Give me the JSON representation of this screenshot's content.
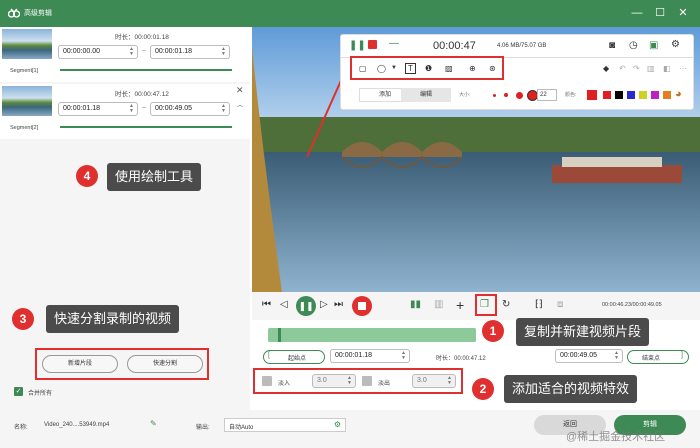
{
  "window": {
    "title": "高级剪辑"
  },
  "segments": [
    {
      "name": "Segment[1]",
      "duration_label": "时长：00:00:01.18",
      "start": "00:00:00.00",
      "end": "00:00:01.18",
      "progress": 1.0
    },
    {
      "name": "Segment[2]",
      "duration_label": "时长：00:00:47.12",
      "start": "00:00:01.18",
      "end": "00:00:49.05",
      "progress": 1.0
    }
  ],
  "tilde": "~",
  "recorder": {
    "time": "00:00:47",
    "size": "4.06 MB/75.07 GB",
    "tab_add": "添加",
    "tab_edit": "编辑",
    "size_label": "大小:",
    "size_value": "22",
    "color_label": "颜色:"
  },
  "palette": [
    "#e02020",
    "#e02020",
    "#000000",
    "#000000",
    "#2a2ad0",
    "#d0d020",
    "#c020c0",
    "#e08020"
  ],
  "callouts": {
    "c1": {
      "num": "1",
      "text": "复制并新建视频片段"
    },
    "c2": {
      "num": "2",
      "text": "添加适合的视频特效"
    },
    "c3": {
      "num": "3",
      "text": "快速分割录制的视频"
    },
    "c4": {
      "num": "4",
      "text": "使用绘制工具"
    }
  },
  "player": {
    "time": "00:00:46.23/00:00:49.05",
    "play_progress": 0.94
  },
  "trim": {
    "start_btn": "起始点",
    "start_value": "00:00:01.18",
    "duration_label": "时长：00:00:47.12",
    "end_value": "00:00:49.05",
    "end_btn": "结束点",
    "timeline_fill": 1.0
  },
  "effects": {
    "fadein_label": "淡入",
    "fadein_value": "3.0",
    "fadeout_label": "淡出",
    "fadeout_value": "3.0"
  },
  "left_actions": {
    "new_segment": "新增片段",
    "quick_split": "快速分割",
    "merge_all": "合并所有"
  },
  "footer": {
    "name_label": "名称:",
    "name_value": "Video_240....53949.mp4",
    "output_label": "输出:",
    "output_value": "自动Auto",
    "back": "返回",
    "cut": "剪辑"
  },
  "watermark": "@稀土掘金技术社区",
  "colors": {
    "accent": "#3e8a55",
    "callout_bg": "#4b4b4b",
    "marker": "#e02f2f"
  }
}
